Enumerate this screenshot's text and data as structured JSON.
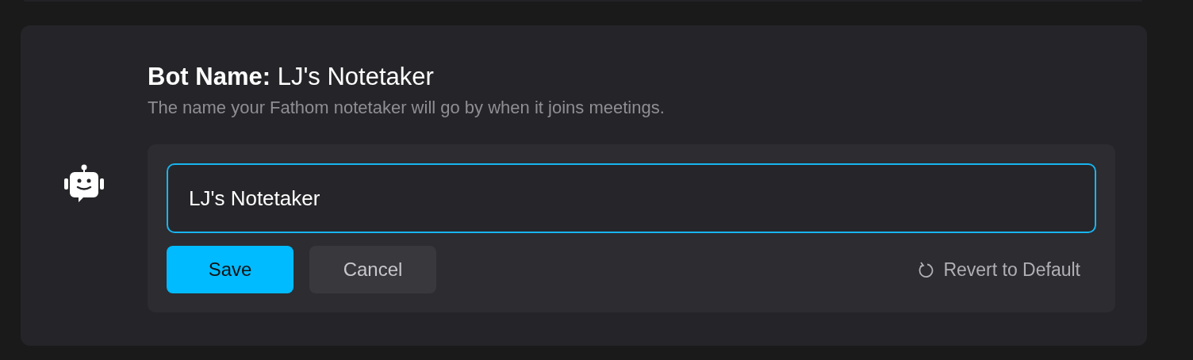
{
  "setting": {
    "label": "Bot Name:",
    "value": "LJ's Notetaker",
    "description": "The name your Fathom notetaker will go by when it joins meetings."
  },
  "field": {
    "value": "LJ's Notetaker",
    "focused": true
  },
  "buttons": [
    {
      "label": "Save",
      "kind": "primary"
    },
    {
      "label": "Cancel",
      "kind": "secondary"
    }
  ],
  "revert": {
    "label": "Revert to Default"
  }
}
